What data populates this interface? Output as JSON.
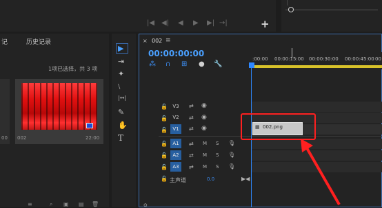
{
  "top": {
    "buttons": [
      "|◀",
      "◀|",
      "◀",
      "▶",
      "▶|",
      "→|"
    ],
    "add_label": "+"
  },
  "project": {
    "tab_left": "记",
    "tab_history": "历史记录",
    "items_info": "1项已选择，共 3 项",
    "thumb_left_label": "00",
    "thumb_name": "002",
    "thumb_duration": "22:00",
    "bottom_icons": [
      "≡",
      "⌕",
      "▣",
      "▤",
      "🗑"
    ]
  },
  "tools": [
    "▶",
    "⇥",
    "✦",
    "⧵",
    "|↔|",
    "✎",
    "✋",
    "T"
  ],
  "timeline": {
    "close": "×",
    "sequence_name": "002",
    "menu": "≡",
    "timecode": "00:00:00:00",
    "controls": [
      "⁂",
      "∩",
      "⊞",
      "●",
      "🔧"
    ],
    "ruler_ticks": [
      ":00:00",
      "00:00:15:00",
      "00:00:30:00",
      "00:00:45:00",
      "00"
    ],
    "video_tracks": [
      {
        "label": "V3",
        "active": false
      },
      {
        "label": "V2",
        "active": false
      },
      {
        "label": "V1",
        "active": true
      }
    ],
    "audio_tracks": [
      {
        "label": "A1",
        "mute": "M",
        "solo": "S"
      },
      {
        "label": "A2",
        "mute": "M",
        "solo": "S"
      },
      {
        "label": "A3",
        "mute": "M",
        "solo": "S"
      }
    ],
    "master_label": "主声道",
    "master_value": "0.0",
    "master_toggle": "▶◀",
    "clip_name": "002.png",
    "bottom_icon": "⊙"
  },
  "colors": {
    "accent": "#2e88ff",
    "highlight": "#ff2020",
    "work_area": "#d8c22a",
    "active_track": "#275fa0"
  }
}
